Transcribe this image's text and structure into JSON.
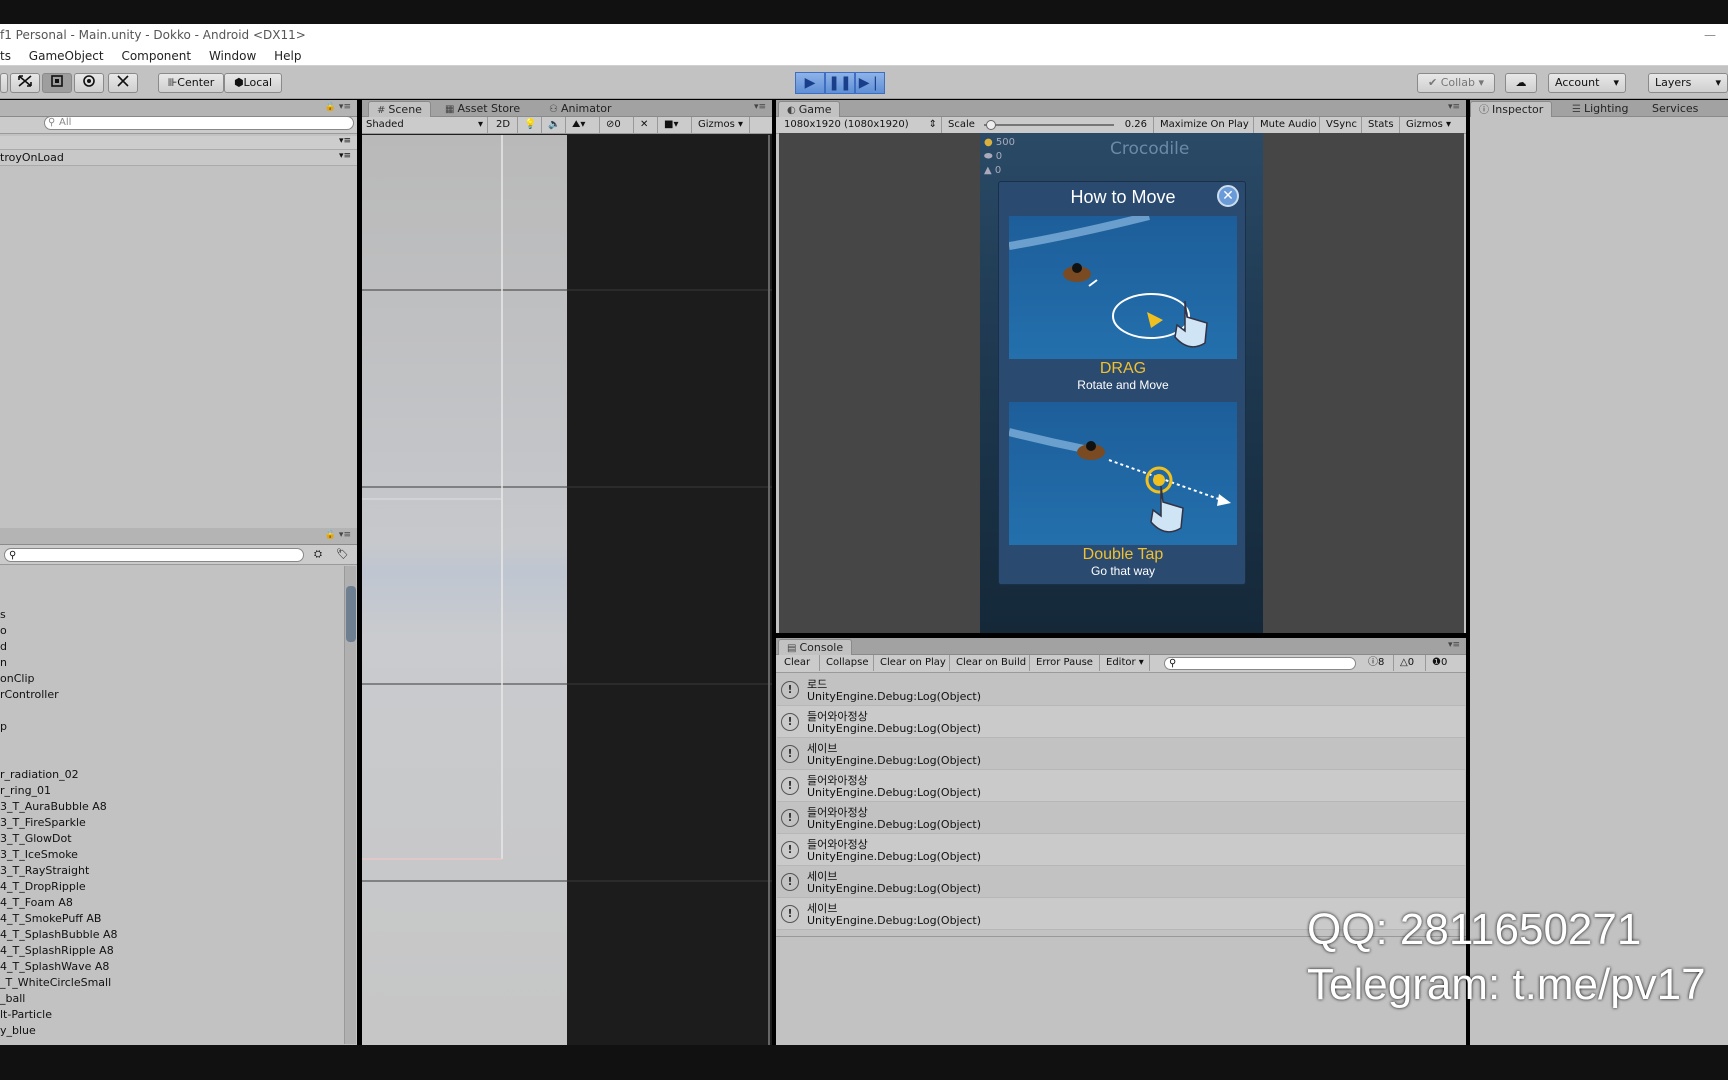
{
  "window": {
    "title": "f1 Personal - Main.unity - Dokko - Android <DX11>"
  },
  "menu": [
    "ts",
    "GameObject",
    "Component",
    "Window",
    "Help"
  ],
  "toolbar": {
    "pivot_label": "Center",
    "space_label": "Local",
    "collab_label": "Collab",
    "account_label": "Account",
    "layers_label": "Layers"
  },
  "hierarchy": {
    "search_placeholder": "All",
    "scene_item": "troyOnLoad"
  },
  "scene_tabs": {
    "scene": "Scene",
    "asset_store": "Asset Store",
    "animator": "Animator",
    "shading": "Shaded",
    "mode_2d": "2D",
    "hidden_count": "0",
    "gizmos": "Gizmos"
  },
  "game": {
    "tab": "Game",
    "resolution": "1080x1920 (1080x1920)",
    "scale_label": "Scale",
    "scale_value": "0.26",
    "scale_level": 0.05,
    "maximize": "Maximize On Play",
    "mute": "Mute Audio",
    "vsync": "VSync",
    "stats": "Stats",
    "gizmos": "Gizmos",
    "hud": {
      "coins": "500",
      "val_a": "0",
      "val_b": "0",
      "banner": "Crocodile"
    },
    "dialog": {
      "title": "How to Move",
      "drag_title": "DRAG",
      "drag_sub": "Rotate and Move",
      "tap_title": "Double Tap",
      "tap_sub": "Go that way"
    }
  },
  "inspector": {
    "tab_inspector": "Inspector",
    "tab_lighting": "Lighting",
    "tab_services": "Services"
  },
  "console": {
    "tab": "Console",
    "clear": "Clear",
    "collapse": "Collapse",
    "clear_on_play": "Clear on Play",
    "clear_on_build": "Clear on Build",
    "error_pause": "Error Pause",
    "editor": "Editor",
    "count_log": "8",
    "count_warn": "0",
    "count_err": "0",
    "entries": [
      {
        "msg": "로드",
        "src": "UnityEngine.Debug:Log(Object)"
      },
      {
        "msg": "들어와아정상",
        "src": "UnityEngine.Debug:Log(Object)"
      },
      {
        "msg": "세이브",
        "src": "UnityEngine.Debug:Log(Object)"
      },
      {
        "msg": "들어와아정상",
        "src": "UnityEngine.Debug:Log(Object)"
      },
      {
        "msg": "들어와아정상",
        "src": "UnityEngine.Debug:Log(Object)"
      },
      {
        "msg": "들어와아정상",
        "src": "UnityEngine.Debug:Log(Object)"
      },
      {
        "msg": "세이브",
        "src": "UnityEngine.Debug:Log(Object)"
      },
      {
        "msg": "세이브",
        "src": "UnityEngine.Debug:Log(Object)"
      }
    ]
  },
  "project": {
    "items": [
      "s",
      "o",
      "d",
      "n",
      "onClip",
      "rController",
      "",
      "p",
      "",
      "",
      "r_radiation_02",
      "r_ring_01",
      "3_T_AuraBubble A8",
      "3_T_FireSparkle",
      "3_T_GlowDot",
      "3_T_IceSmoke",
      "3_T_RayStraight",
      "4_T_DropRipple",
      "4_T_Foam A8",
      "4_T_SmokePuff AB",
      "4_T_SplashBubble A8",
      "4_T_SplashRipple A8",
      "4_T_SplashWave A8",
      "_T_WhiteCircleSmall",
      "_ball",
      "lt-Particle",
      "y_blue"
    ]
  },
  "watermark": {
    "line1": "QQ: 2811650271",
    "line2": "Telegram: t.me/pv17"
  }
}
